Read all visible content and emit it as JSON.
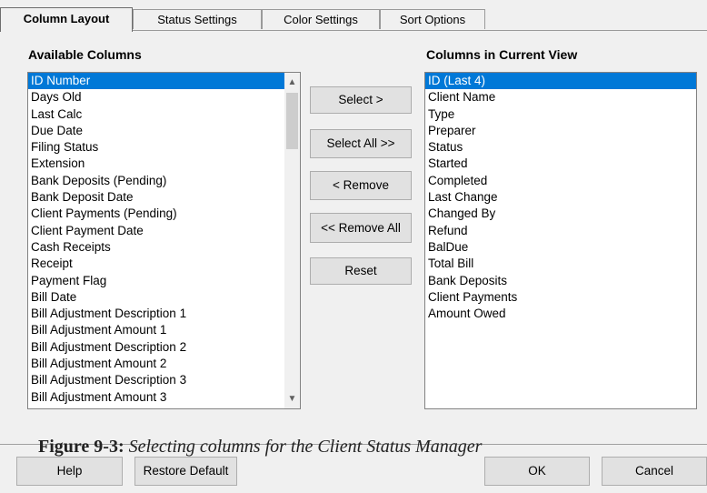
{
  "tabs": [
    {
      "label": "Column Layout",
      "active": true
    },
    {
      "label": "Status Settings",
      "active": false
    },
    {
      "label": "Color Settings",
      "active": false
    },
    {
      "label": "Sort Options",
      "active": false
    }
  ],
  "available": {
    "label": "Available Columns",
    "items": [
      "ID Number",
      "Days Old",
      "Last Calc",
      "Due Date",
      "Filing Status",
      "Extension",
      "Bank Deposits (Pending)",
      "Bank Deposit Date",
      "Client Payments (Pending)",
      "Client Payment Date",
      "Cash Receipts",
      "Receipt",
      "Payment Flag",
      "Bill Date",
      "Bill Adjustment Description 1",
      "Bill Adjustment Amount 1",
      "Bill Adjustment Description 2",
      "Bill Adjustment Amount 2",
      "Bill Adjustment Description 3",
      "Bill Adjustment Amount 3"
    ],
    "selected_index": 0
  },
  "current": {
    "label": "Columns in Current View",
    "items": [
      "ID (Last 4)",
      "Client Name",
      "Type",
      "Preparer",
      "Status",
      "Started",
      "Completed",
      "Last Change",
      "Changed By",
      "Refund",
      "BalDue",
      "Total Bill",
      "Bank Deposits",
      "Client Payments",
      "Amount Owed"
    ],
    "selected_index": 0
  },
  "actions": {
    "select": "Select >",
    "select_all": "Select All >>",
    "remove": "< Remove",
    "remove_all": "<< Remove All",
    "reset": "Reset"
  },
  "caption": {
    "figure": "Figure 9-3:",
    "text": " Selecting columns for the Client Status Manager"
  },
  "footer": {
    "help": "Help",
    "restore_default": "Restore Default",
    "ok": "OK",
    "cancel": "Cancel"
  },
  "colors": {
    "selection": "#0078d7",
    "background": "#f0f0f0"
  }
}
